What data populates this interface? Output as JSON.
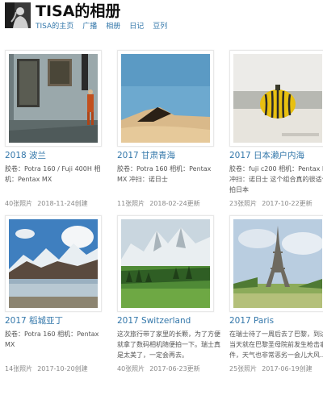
{
  "header": {
    "title": "TISA的相册",
    "avatar_icon": "silhouette-avatar",
    "nav": [
      {
        "label": "TISA的主页"
      },
      {
        "label": "广播"
      },
      {
        "label": "相册"
      },
      {
        "label": "日记"
      },
      {
        "label": "豆列"
      }
    ]
  },
  "albums": [
    {
      "title": "2018 波兰",
      "desc": "胶卷：Potra 160 / Fuji 400H 相机：Pentax MX",
      "count": "40张照片",
      "date": "2018-11-24创建",
      "thumb": "street-wall-photo"
    },
    {
      "title": "2017 甘肃青海",
      "desc": "胶卷：Potra 160 相机：Pentax MX 冲扫：诺日士",
      "count": "11张照片",
      "date": "2018-02-24更新",
      "thumb": "desert-dune-photo"
    },
    {
      "title": "2017 日本濑户内海",
      "desc": "胶卷：fuji c200 相机：Pentax MX 冲扫：诺日士 这个组合真的很适合拍日本",
      "count": "23张照片",
      "date": "2017-10-22更新",
      "thumb": "pumpkin-sculpture-photo"
    },
    {
      "title": "2017 稻城亚丁",
      "desc": "胶卷：Potra 160 相机：Pentax MX",
      "count": "14张照片",
      "date": "2017-10-20创建",
      "thumb": "mountain-lake-photo"
    },
    {
      "title": "2017 Switzerland",
      "desc": "这次旅行带了家里的长颗，为了方便就拿了数码相机随便拍一下。瑞士真是太美了，一定会再去。",
      "count": "40张照片",
      "date": "2017-06-23更新",
      "thumb": "alps-meadow-photo"
    },
    {
      "title": "2017 Paris",
      "desc": "在瑞士待了一周后去了巴黎，到达的当天就在巴黎圣母院前发生枪击事件，天气也非常恶劣一会儿大风…",
      "count": "25张照片",
      "date": "2017-06-19创建",
      "thumb": "eiffel-tower-photo"
    }
  ]
}
